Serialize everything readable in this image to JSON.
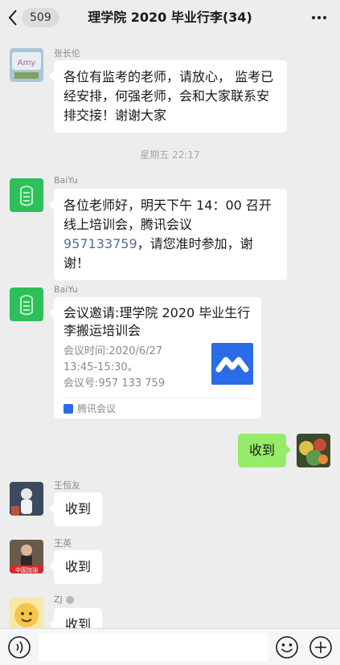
{
  "header": {
    "unread_count": "509",
    "title": "理学院 2020 毕业行李(34)",
    "icons": {
      "back": "chevron-left-icon",
      "more": "more-dots-icon"
    }
  },
  "messages": [
    {
      "sender": "张长伦",
      "avatar_text": "Amy",
      "text": "各位有监考的老师，请放心， 监考已经安排，何强老师，会和大家联系安排交接！谢谢大家"
    },
    {
      "timestamp": "星期五 22:17"
    },
    {
      "sender": "BaiYu",
      "text_pre": "各位老师好，明天下午 14：00 召开线上培训会，腾讯会议",
      "link": "957133759",
      "text_post": "，请您准时参加，谢谢！"
    },
    {
      "sender": "BaiYu",
      "card": {
        "title": "会议邀请:理学院 2020 毕业生行李搬运培训会",
        "time_line": "会议时间:2020/6/27 13:45-15:30。",
        "id_line": "会议号:957 133 759",
        "app_name": "腾讯会议"
      }
    },
    {
      "self": true,
      "text": "收到"
    },
    {
      "sender": "王恒友",
      "text": "收到"
    },
    {
      "sender": "王英",
      "avatar_text": "中国加油",
      "text": "收到"
    },
    {
      "sender": "ZJ",
      "text": "收到"
    }
  ],
  "input_bar": {
    "placeholder": "",
    "icons": [
      "voice-icon",
      "emoji-icon",
      "plus-icon"
    ]
  },
  "colors": {
    "background": "#ededed",
    "self_bubble": "#95ec69",
    "link": "#576b95",
    "tencent_meeting": "#2a6be6"
  }
}
